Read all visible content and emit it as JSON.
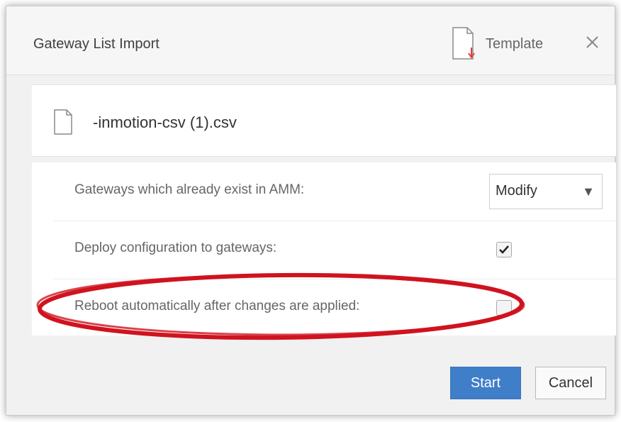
{
  "dialog": {
    "title": "Gateway List Import",
    "template_label": "Template",
    "close_icon": "close-icon",
    "file_icon": "file-icon",
    "template_icon": "file-download-icon"
  },
  "file": {
    "name": "-inmotion-csv (1).csv"
  },
  "options": {
    "existing_label": "Gateways which already exist in AMM:",
    "existing_value": "Modify",
    "required_mark": "*",
    "deploy_label": "Deploy configuration to gateways:",
    "deploy_checked": true,
    "reboot_label": "Reboot automatically after changes are applied:",
    "reboot_checked": false
  },
  "footer": {
    "start_label": "Start",
    "cancel_label": "Cancel"
  },
  "colors": {
    "primary": "#3f7ec9",
    "required": "#e2403a",
    "annotation": "#d0131f"
  }
}
